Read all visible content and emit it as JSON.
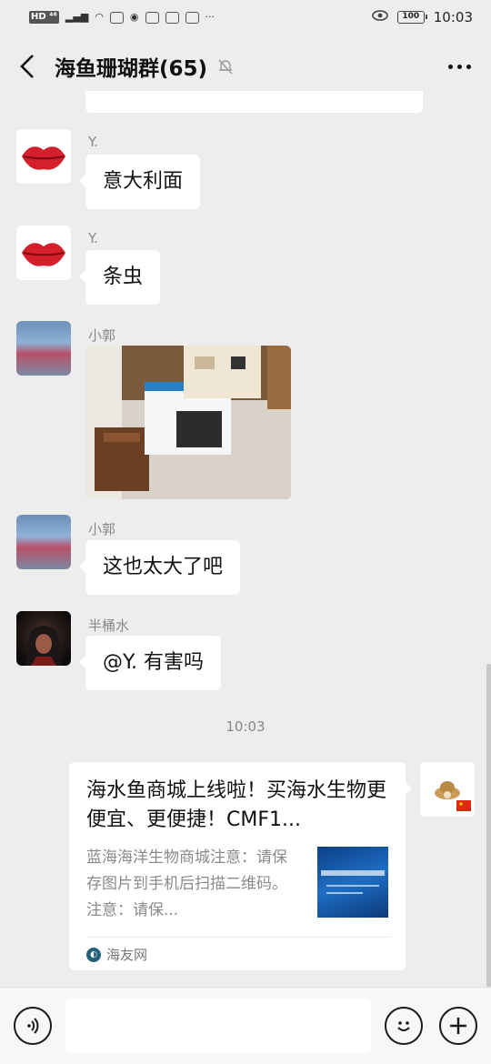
{
  "status_bar": {
    "signal": "HD ⁴⁶",
    "battery": "100",
    "time": "10:03"
  },
  "header": {
    "title": "海鱼珊瑚群(65)"
  },
  "messages": [
    {
      "sender": "Y.",
      "text": "意大利面",
      "avatar": "red-lips"
    },
    {
      "sender": "Y.",
      "text": "条虫",
      "avatar": "red-lips"
    },
    {
      "sender": "小郭",
      "type": "image",
      "avatar": "girl-fishing"
    },
    {
      "sender": "小郭",
      "text": "这也太大了吧",
      "avatar": "girl-fishing"
    },
    {
      "sender": "半桶水",
      "text": "@Y. 有害吗",
      "avatar": "hooded-assassin"
    }
  ],
  "timestamp": "10:03",
  "shared_card": {
    "title": "海水鱼商城上线啦！买海水生物更便宜、更便捷！CMF1...",
    "description": "蓝海海洋生物商城注意：请保存图片到手机后扫描二维码。注意：请保...",
    "source": "海友网"
  },
  "input": {
    "value": ""
  },
  "colors": {
    "background": "#ededed",
    "bubble": "#ffffff",
    "meta_text": "#888888"
  }
}
